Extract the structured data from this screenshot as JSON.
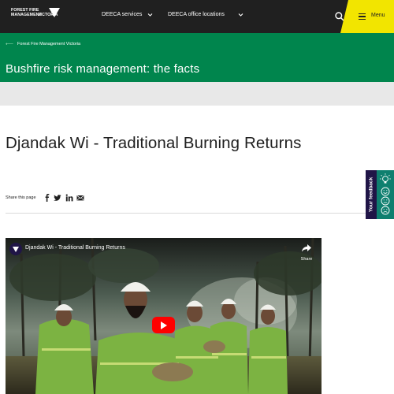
{
  "header": {
    "logo_line1": "FOREST FIRE",
    "logo_line2": "MANAGEMENT",
    "logo_state": "VICTORIA",
    "nav": [
      {
        "label": "DEECA services"
      },
      {
        "label": "DEECA office locations"
      }
    ],
    "search_icon": "search-icon",
    "menu_label": "Menu",
    "menu_color": "#f2e500"
  },
  "banner": {
    "breadcrumb": "Forest Fire Management Victoria",
    "title": "Bushfire risk management: the facts",
    "color": "#00854d"
  },
  "article": {
    "title": "Djandak Wi - Traditional Burning Returns",
    "share_label": "Share this page",
    "share_icons": [
      "facebook-icon",
      "twitter-icon",
      "linkedin-icon",
      "email-icon"
    ]
  },
  "feedback": {
    "label": "Your feedback",
    "colors": {
      "label_bg": "#201547",
      "icons_bg": "#0e7f6f"
    }
  },
  "video": {
    "title": "Djandak Wi - Traditional Burning Returns",
    "share_label": "Share",
    "play_color": "#ff0000"
  }
}
